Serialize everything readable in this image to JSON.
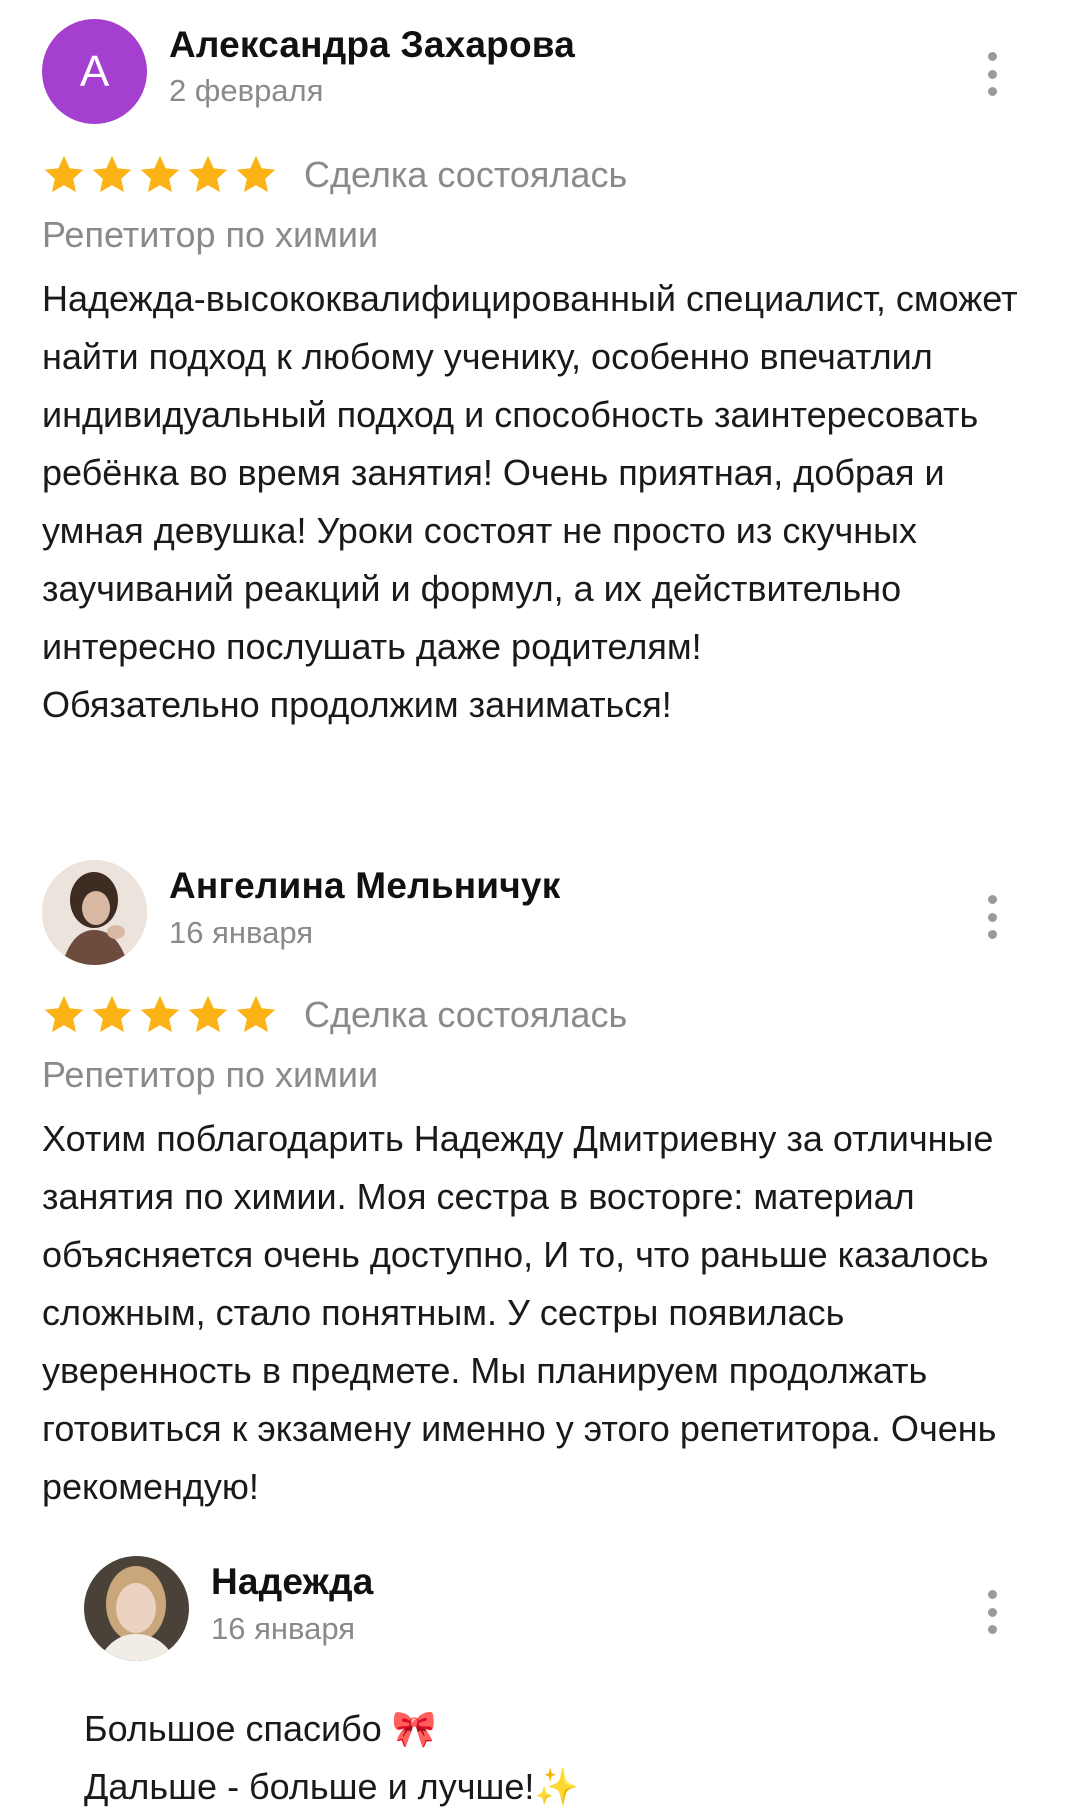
{
  "reviews": [
    {
      "avatar_letter": "А",
      "avatar_color": "#a43fcf",
      "author": "Александра Захарова",
      "date": "2 февраля",
      "rating": 5,
      "status": "Сделка состоялась",
      "category": "Репетитор по химии",
      "text": "Надежда-высококвалифицированный специалист, сможет найти подход к любому ученику, особенно впечатлил индивидуальный подход и способность заинтересовать ребёнка во время занятия! Очень приятная, добрая и умная девушка! Уроки состоят не просто из скучных заучиваний реакций и формул, а их действительно интересно послушать даже родителям!\n Обязательно продолжим заниматься!"
    },
    {
      "author": "Ангелина Мельничук",
      "date": "16 января",
      "rating": 5,
      "status": "Сделка состоялась",
      "category": "Репетитор по химии",
      "text": "Хотим поблагодарить Надежду Дмитриевну за отличные занятия по химии. Моя сестра в восторге: материал объясняется очень доступно, И то, что раньше казалось сложным, стало понятным. У сестры появилась уверенность в предмете. Мы планируем продолжать готовиться к экзамену именно у этого репетитора. Очень рекомендую!",
      "reply": {
        "author": "Надежда",
        "date": "16 января",
        "text": "Большое спасибо 🎀\nДальше - больше и лучше!✨"
      }
    }
  ],
  "colors": {
    "star": "#fbb315",
    "muted": "#8a8a8a",
    "text": "#1a1a1a"
  },
  "icons": {
    "star": "star-icon",
    "menu": "more-vertical-icon"
  }
}
